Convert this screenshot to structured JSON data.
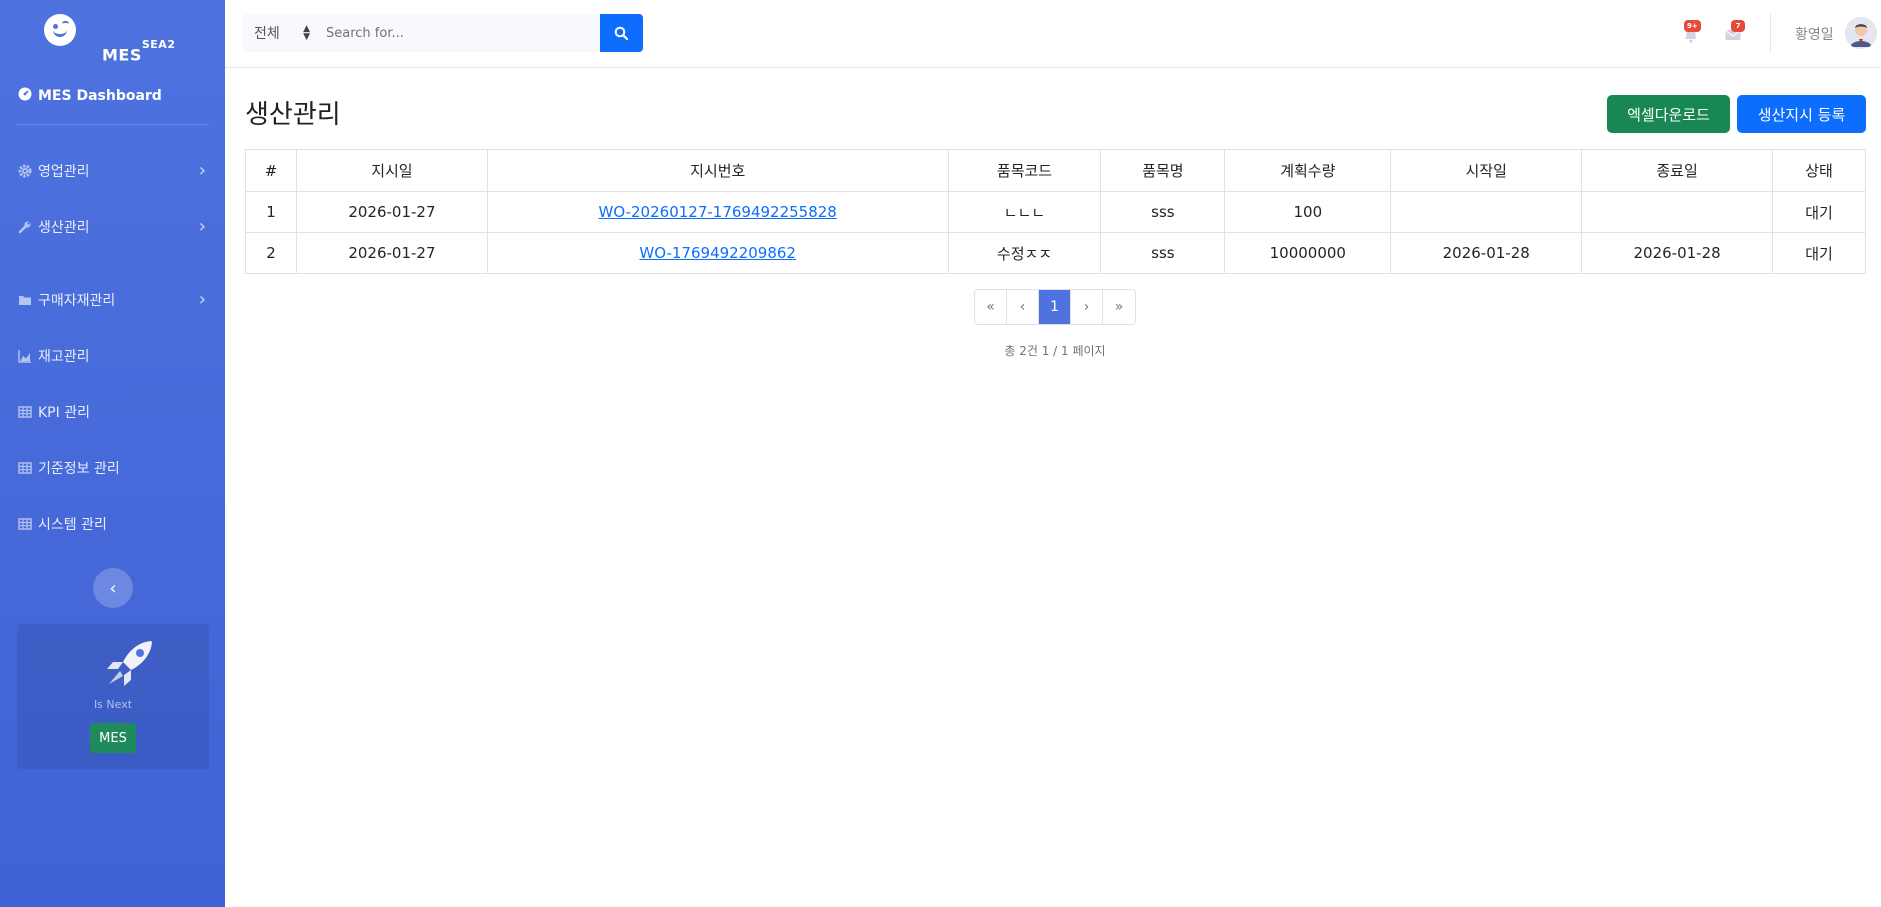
{
  "brand": {
    "name": "MES",
    "suffix": "SEA2"
  },
  "sidebar": {
    "dashboard": "MES Dashboard",
    "items": [
      {
        "label": "영업관리",
        "icon": "gear-icon",
        "has_children": true
      },
      {
        "label": "생산관리",
        "icon": "wrench-icon",
        "has_children": true
      },
      {
        "label": "구매자재관리",
        "icon": "folder-icon",
        "has_children": true
      },
      {
        "label": "재고관리",
        "icon": "chart-area-icon",
        "has_children": false
      },
      {
        "label": "KPI 관리",
        "icon": "table-icon",
        "has_children": false
      },
      {
        "label": "기준정보 관리",
        "icon": "table-icon",
        "has_children": false
      },
      {
        "label": "시스템 관리",
        "icon": "table-icon",
        "has_children": false
      }
    ],
    "promo": {
      "text": "Is Next",
      "button": "MES"
    }
  },
  "topbar": {
    "search": {
      "select_value": "전체",
      "placeholder": "Search for..."
    },
    "alerts_badge": "9+",
    "messages_badge": "7",
    "user_name": "황영일"
  },
  "page": {
    "title": "생산관리",
    "excel_button": "엑셀다운로드",
    "register_button": "생산지시 등록"
  },
  "table": {
    "columns": [
      "#",
      "지시일",
      "지시번호",
      "품목코드",
      "품목명",
      "계획수량",
      "시작일",
      "종료일",
      "상태"
    ],
    "rows": [
      {
        "no": "1",
        "order_date": "2026-01-27",
        "order_no": "WO-20260127-1769492255828",
        "item_code": "ㄴㄴㄴ",
        "item_name": "sss",
        "qty": "100",
        "start": "",
        "end": "",
        "status": "대기"
      },
      {
        "no": "2",
        "order_date": "2026-01-27",
        "order_no": "WO-1769492209862",
        "item_code": "수정ㅈㅈ",
        "item_name": "sss",
        "qty": "10000000",
        "start": "2026-01-28",
        "end": "2026-01-28",
        "status": "대기"
      }
    ]
  },
  "pagination": {
    "first": "«",
    "prev": "‹",
    "current": "1",
    "next": "›",
    "last": "»",
    "summary": "총 2건 1 / 1 페이지"
  },
  "colors": {
    "sidebar": "#4e73df",
    "primary": "#0d6efd",
    "success": "#198754",
    "danger": "#e74a3b"
  }
}
